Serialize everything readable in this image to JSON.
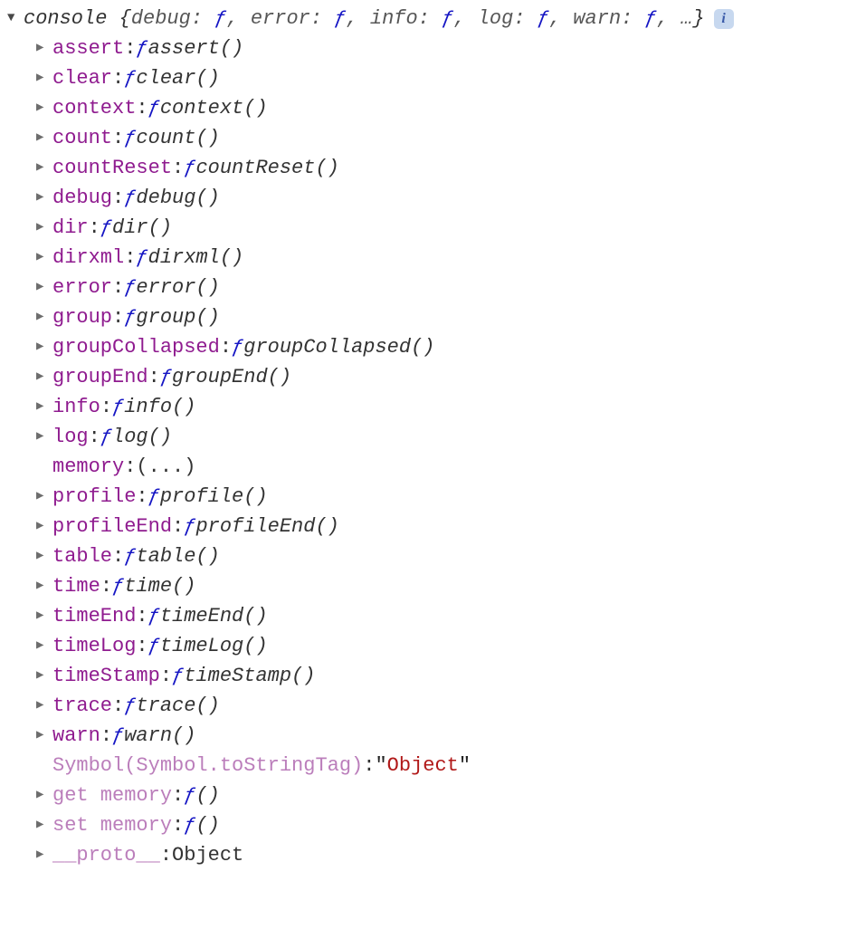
{
  "header": {
    "object_name": "console",
    "preview_keys": [
      "debug",
      "error",
      "info",
      "log",
      "warn"
    ],
    "f_symbol": "ƒ",
    "ellipsis": "…",
    "info_letter": "i"
  },
  "entries": [
    {
      "key": "assert",
      "kind": "fn",
      "fn_name": "assert()",
      "expandable": true,
      "dim": false
    },
    {
      "key": "clear",
      "kind": "fn",
      "fn_name": "clear()",
      "expandable": true,
      "dim": false
    },
    {
      "key": "context",
      "kind": "fn",
      "fn_name": "context()",
      "expandable": true,
      "dim": false
    },
    {
      "key": "count",
      "kind": "fn",
      "fn_name": "count()",
      "expandable": true,
      "dim": false
    },
    {
      "key": "countReset",
      "kind": "fn",
      "fn_name": "countReset()",
      "expandable": true,
      "dim": false
    },
    {
      "key": "debug",
      "kind": "fn",
      "fn_name": "debug()",
      "expandable": true,
      "dim": false
    },
    {
      "key": "dir",
      "kind": "fn",
      "fn_name": "dir()",
      "expandable": true,
      "dim": false
    },
    {
      "key": "dirxml",
      "kind": "fn",
      "fn_name": "dirxml()",
      "expandable": true,
      "dim": false
    },
    {
      "key": "error",
      "kind": "fn",
      "fn_name": "error()",
      "expandable": true,
      "dim": false
    },
    {
      "key": "group",
      "kind": "fn",
      "fn_name": "group()",
      "expandable": true,
      "dim": false
    },
    {
      "key": "groupCollapsed",
      "kind": "fn",
      "fn_name": "groupCollapsed()",
      "expandable": true,
      "dim": false
    },
    {
      "key": "groupEnd",
      "kind": "fn",
      "fn_name": "groupEnd()",
      "expandable": true,
      "dim": false
    },
    {
      "key": "info",
      "kind": "fn",
      "fn_name": "info()",
      "expandable": true,
      "dim": false
    },
    {
      "key": "log",
      "kind": "fn",
      "fn_name": "log()",
      "expandable": true,
      "dim": false
    },
    {
      "key": "memory",
      "kind": "literal",
      "literal": "(...)",
      "expandable": false,
      "dim": false
    },
    {
      "key": "profile",
      "kind": "fn",
      "fn_name": "profile()",
      "expandable": true,
      "dim": false
    },
    {
      "key": "profileEnd",
      "kind": "fn",
      "fn_name": "profileEnd()",
      "expandable": true,
      "dim": false
    },
    {
      "key": "table",
      "kind": "fn",
      "fn_name": "table()",
      "expandable": true,
      "dim": false
    },
    {
      "key": "time",
      "kind": "fn",
      "fn_name": "time()",
      "expandable": true,
      "dim": false
    },
    {
      "key": "timeEnd",
      "kind": "fn",
      "fn_name": "timeEnd()",
      "expandable": true,
      "dim": false
    },
    {
      "key": "timeLog",
      "kind": "fn",
      "fn_name": "timeLog()",
      "expandable": true,
      "dim": false
    },
    {
      "key": "timeStamp",
      "kind": "fn",
      "fn_name": "timeStamp()",
      "expandable": true,
      "dim": false
    },
    {
      "key": "trace",
      "kind": "fn",
      "fn_name": "trace()",
      "expandable": true,
      "dim": false
    },
    {
      "key": "warn",
      "kind": "fn",
      "fn_name": "warn()",
      "expandable": true,
      "dim": false
    },
    {
      "key": "Symbol(Symbol.toStringTag)",
      "kind": "string",
      "string_val": "Object",
      "expandable": false,
      "dim": true
    },
    {
      "key": "get memory",
      "kind": "fn",
      "fn_name": "()",
      "expandable": true,
      "dim": true
    },
    {
      "key": "set memory",
      "kind": "fn",
      "fn_name": "()",
      "expandable": true,
      "dim": true
    },
    {
      "key": "__proto__",
      "kind": "plain",
      "plain_val": "Object",
      "expandable": true,
      "dim": true
    }
  ]
}
